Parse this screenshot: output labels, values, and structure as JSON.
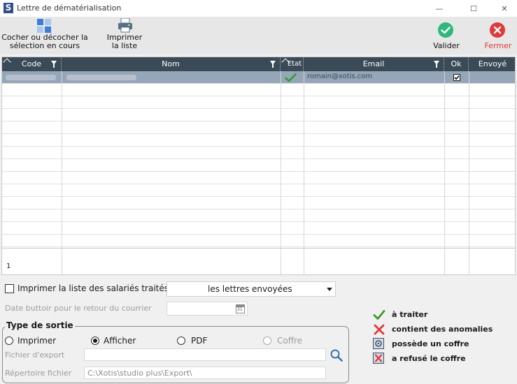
{
  "window": {
    "title": "Lettre de dématérialisation",
    "logo": "S",
    "controls": {
      "minimize": "—",
      "maximize": "☐",
      "close": "✕"
    }
  },
  "toolbar": {
    "select_toggle": {
      "line1": "Cocher ou décocher la",
      "line2": "sélection en cours"
    },
    "print_list": {
      "line1": "Imprimer",
      "line2": "la liste"
    },
    "validate": "Valider",
    "close": "Fermer"
  },
  "grid": {
    "columns": {
      "code": "Code",
      "nom": "Nom",
      "etat": "Etat",
      "email": "Email",
      "ok": "Ok",
      "envoye": "Envoyé"
    },
    "rows": [
      {
        "code": "",
        "nom": "",
        "etat_icon": "check-icon",
        "email": "romain@xotis.com",
        "ok": true
      }
    ],
    "count": "1"
  },
  "print_list_option": {
    "label": "Imprimer la liste des salariés traités",
    "selected": "les lettres envoyées"
  },
  "deadline": {
    "label": "Date buttoir pour le retour du courrier",
    "calendar_day": "31"
  },
  "output": {
    "legend": "Type de sortie",
    "options": {
      "imprimer": "Imprimer",
      "afficher": "Afficher",
      "pdf": "PDF",
      "coffre": "Coffre"
    },
    "export_file_label": "Fichier d'export",
    "directory_label": "Répertoire fichier",
    "directory_value": "C:\\Xotis\\studio plus\\Export\\"
  },
  "legend": {
    "a_traiter": "à traiter",
    "anomalies": "contient des anomalies",
    "possede_coffre": "possède un coffre",
    "refuse_coffre": "a refusé le coffre"
  },
  "colors": {
    "header": "#3a4a57",
    "selected_row": "#94a6b8",
    "validate": "#2db87d",
    "close": "#e0393b"
  }
}
